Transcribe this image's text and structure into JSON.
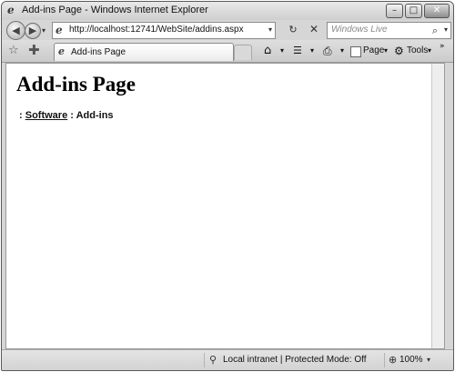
{
  "window": {
    "title": "Add-ins Page - Windows Internet Explorer",
    "buttons": {
      "minimize": "–",
      "maximize": "□",
      "close": "✕"
    }
  },
  "nav": {
    "back_glyph": "◀",
    "forward_glyph": "▶",
    "address": "http://localhost:12741/WebSite/addins.aspx",
    "refresh_glyph": "↻",
    "stop_glyph": "✕",
    "search_placeholder": "Windows Live",
    "search_glyph": "⌕"
  },
  "tabs": [
    {
      "label": "Add-ins Page"
    }
  ],
  "command_bar": {
    "home_glyph": "⌂",
    "feeds_glyph": "☰",
    "print_glyph": "⎙",
    "page_label": "Page",
    "tools_label": "Tools",
    "tools_glyph": "⚙",
    "more_glyph": "»",
    "dropdown_glyph": "▾"
  },
  "page": {
    "heading": "Add-ins Page",
    "breadcrumb_prefix": ":",
    "breadcrumb_link": "Software",
    "breadcrumb_separator": ":",
    "breadcrumb_current": "Add-ins"
  },
  "status": {
    "zone": "Local intranet | Protected Mode: Off",
    "zone_glyph": "⚲",
    "zoom": "100%",
    "zoom_glyph": "⊕"
  },
  "favorites": {
    "star_glyph": "☆",
    "add_glyph": "✚"
  },
  "icons": {
    "ie_glyph": "e"
  }
}
